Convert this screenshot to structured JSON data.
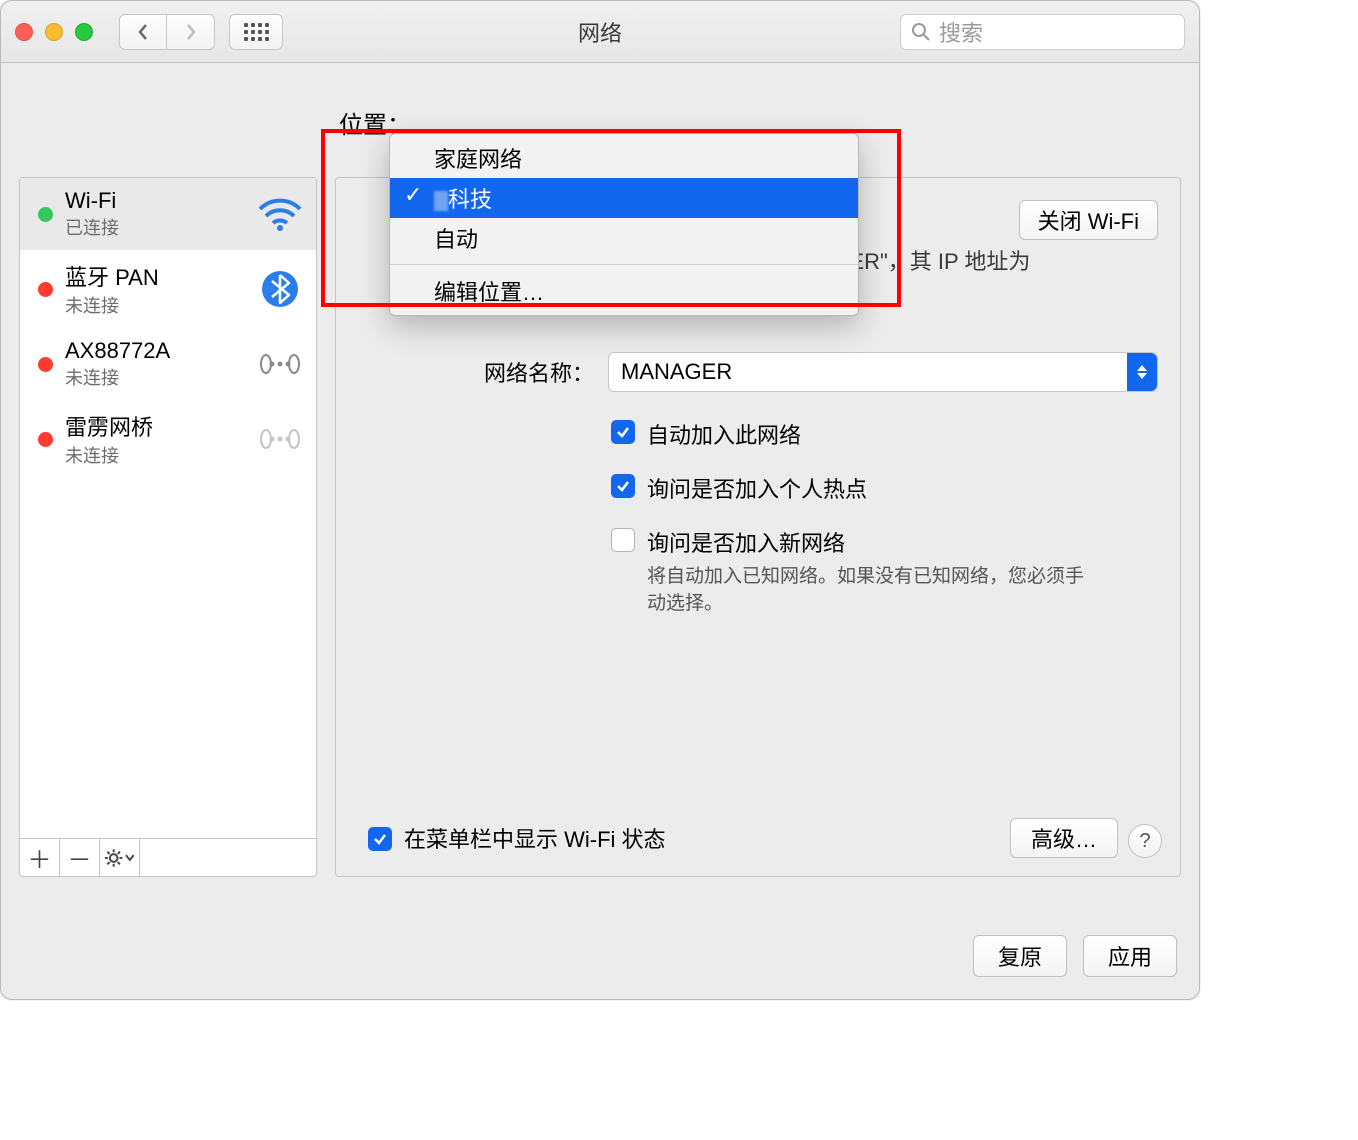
{
  "window_title": "网络",
  "search_placeholder": "搜索",
  "location_label": "位置：",
  "dropdown": {
    "items": [
      "家庭网络",
      "科技",
      "自动"
    ],
    "selected_partial": "科技",
    "edit_label": "编辑位置…"
  },
  "sidebar": {
    "items": [
      {
        "name": "Wi-Fi",
        "status": "已连接",
        "dot": "green",
        "icon": "wifi"
      },
      {
        "name": "蓝牙 PAN",
        "status": "未连接",
        "dot": "red",
        "icon": "bluetooth"
      },
      {
        "name": "AX88772A",
        "status": "未连接",
        "dot": "red",
        "icon": "ethernet"
      },
      {
        "name": "雷雳网桥",
        "status": "未连接",
        "dot": "red",
        "icon": "ethernet-off"
      }
    ]
  },
  "main": {
    "turn_off_label": "关闭 Wi-Fi",
    "status_line_prefix": "\"Wi-Fi\"已连接至\"MANAGER\"，其 IP 地址为",
    "status_line_suffix": "。",
    "network_name_label": "网络名称：",
    "network_name_value": "MANAGER",
    "auto_join_label": "自动加入此网络",
    "ask_hotspot_label": "询问是否加入个人热点",
    "ask_new_label": "询问是否加入新网络",
    "ask_new_help": "将自动加入已知网络。如果没有已知网络，您必须手动选择。",
    "menubar_label": "在菜单栏中显示 Wi-Fi 状态",
    "advanced_label": "高级…",
    "help_symbol": "?"
  },
  "buttons": {
    "revert": "复原",
    "apply": "应用"
  }
}
